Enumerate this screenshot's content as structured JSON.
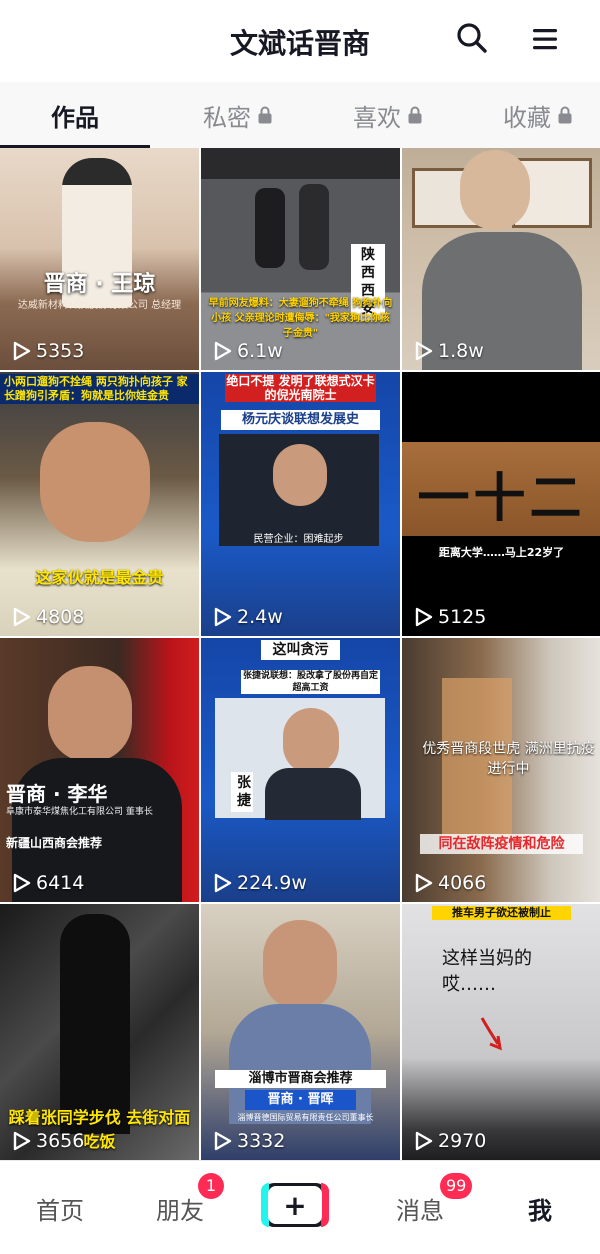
{
  "header": {
    "title": "文斌话晋商",
    "search_icon": "search-icon",
    "menu_icon": "menu-icon"
  },
  "tabs": [
    {
      "label": "作品",
      "locked": false,
      "active": true
    },
    {
      "label": "私密",
      "locked": true,
      "active": false
    },
    {
      "label": "喜欢",
      "locked": true,
      "active": false
    },
    {
      "label": "收藏",
      "locked": true,
      "active": false
    }
  ],
  "videos": [
    {
      "views": "5353",
      "caption": "晋商 · 王琼",
      "sub": "达威新材料科技股份有限公司 总经理"
    },
    {
      "views": "6.1w",
      "caption": "陕西 西安",
      "sub": "早前网友爆料：大妻遛狗不牵绳 狗狗扑向小孩 父亲理论时遭侮辱：\"我家狗比你孩子金贵\""
    },
    {
      "views": "1.8w",
      "caption": "",
      "sub": ""
    },
    {
      "views": "4808",
      "caption": "这家伙就是最金贵",
      "top_caption": "小两口遛狗不拴绳 两只狗扑向孩子 家长蹭狗引矛盾：狗就是比你娃金贵"
    },
    {
      "views": "2.4w",
      "caption": "杨元庆谈联想发展史",
      "top_caption": "绝口不提 发明了联想式汉卡的倪光南院士",
      "sub": "民营企业：困难起步"
    },
    {
      "views": "5125",
      "caption": "一十二",
      "sub": "距离大学……马上22岁了"
    },
    {
      "views": "6414",
      "caption": "晋商 · 李华",
      "sub": "阜康市泰华煤焦化工有限公司 董事长",
      "sub2": "新疆山西商会推荐"
    },
    {
      "views": "224.9w",
      "caption": "这叫贪污",
      "sub": "张捷说联想：股改拿了股份再自定超高工资",
      "name": "张捷"
    },
    {
      "views": "4066",
      "caption": "优秀晋商段世虎 满洲里抗疫进行中",
      "sub": "同在敌阵疫情和危险"
    },
    {
      "views": "3656",
      "caption": "踩着张同学步伐 去街对面吃饭"
    },
    {
      "views": "3332",
      "caption": "淄博市晋商会推荐",
      "sub": "晋商 · 晋晖",
      "sub2": "淄博晋德国际贸易有限责任公司董事长"
    },
    {
      "views": "2970",
      "caption": "这样当妈的 哎……",
      "top_caption": "推车男子欲还被制止"
    }
  ],
  "bottom_nav": {
    "items": [
      {
        "label": "首页",
        "badge": ""
      },
      {
        "label": "朋友",
        "badge": "1"
      },
      {
        "label": "+",
        "badge": ""
      },
      {
        "label": "消息",
        "badge": "99"
      },
      {
        "label": "我",
        "badge": ""
      }
    ]
  },
  "colors": {
    "accent": "#fe2c55",
    "cyan": "#25f4ee",
    "text": "#161823",
    "muted": "#8a8b91"
  }
}
